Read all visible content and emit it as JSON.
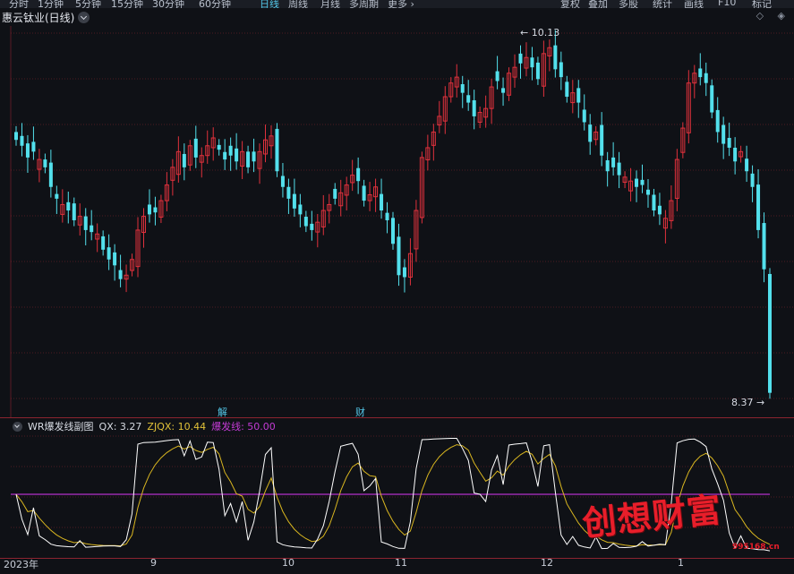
{
  "toolbar": {
    "items": [
      {
        "label": "分时",
        "active": false
      },
      {
        "label": "1分钟",
        "active": false
      },
      {
        "label": "5分钟",
        "active": false
      },
      {
        "label": "15分钟",
        "active": false
      },
      {
        "label": "30分钟",
        "active": false
      },
      {
        "label": "60分钟",
        "active": false
      },
      {
        "label": "日线",
        "active": true
      },
      {
        "label": "周线",
        "active": false
      },
      {
        "label": "月线",
        "active": false
      },
      {
        "label": "多周期",
        "active": false
      },
      {
        "label": "更多 ›",
        "active": false
      }
    ],
    "right_items": [
      "复权",
      "叠加",
      "多股",
      "统计",
      "画线",
      "F10",
      "标记"
    ]
  },
  "chart": {
    "title": "惠云钛业(日线)",
    "price_high_label": "10.13",
    "price_low_label": "8.37",
    "markers": [
      "解",
      "财"
    ],
    "right_icons": "◇ ◈"
  },
  "indicator": {
    "name": "WR爆发线副图",
    "qx_label": "QX: 3.27",
    "zjqx_label": "ZJQX: 10.44",
    "bfx_label": "爆发线: 50.00"
  },
  "xaxis": {
    "labels": [
      "2023年",
      "9",
      "10",
      "11",
      "12",
      "1"
    ]
  },
  "watermark": {
    "text": "创想财富",
    "url": "995168.cn"
  },
  "colors": {
    "up": "#e0313c",
    "down": "#53e0ec",
    "qx": "#ffffff",
    "zjqx": "#d9b620",
    "bfx": "#b331c9",
    "grid": "#8b2430"
  },
  "chart_data": {
    "type": "candlestick",
    "title": "惠云钛业(日线)",
    "ylim": [
      8.3,
      10.25
    ],
    "price_high": 10.13,
    "price_low": 8.37,
    "closes": [
      9.66,
      9.63,
      9.57,
      9.6,
      9.56,
      9.52,
      9.42,
      9.36,
      9.33,
      9.3,
      9.25,
      9.27,
      9.2,
      9.19,
      9.18,
      9.1,
      9.05,
      9.02,
      8.95,
      8.97,
      9.05,
      9.2,
      9.27,
      9.28,
      9.29,
      9.35,
      9.43,
      9.52,
      9.6,
      9.52,
      9.63,
      9.57,
      9.58,
      9.63,
      9.67,
      9.61,
      9.56,
      9.58,
      9.55,
      9.6,
      9.52,
      9.55,
      9.6,
      9.66,
      9.68,
      9.5,
      9.42,
      9.36,
      9.31,
      9.28,
      9.22,
      9.2,
      9.24,
      9.3,
      9.33,
      9.36,
      9.39,
      9.43,
      9.48,
      9.45,
      9.35,
      9.38,
      9.42,
      9.3,
      9.25,
      9.13,
      8.97,
      8.96,
      9.08,
      9.3,
      9.57,
      9.62,
      9.7,
      9.78,
      9.88,
      9.95,
      9.98,
      9.9,
      9.85,
      9.78,
      9.8,
      9.82,
      9.93,
      9.96,
      9.9,
      10.0,
      10.03,
      10.05,
      10.08,
      10.03,
      9.97,
      10.1,
      10.13,
      10.02,
      9.98,
      9.88,
      9.9,
      9.85,
      9.75,
      9.65,
      9.7,
      9.58,
      9.5,
      9.52,
      9.48,
      9.47,
      9.45,
      9.42,
      9.43,
      9.38,
      9.3,
      9.28,
      9.26,
      9.35,
      9.56,
      9.72,
      9.95,
      10.0,
      9.98,
      9.95,
      9.8,
      9.7,
      9.64,
      9.62,
      9.55,
      9.6,
      9.5,
      9.42,
      9.2,
      9.0,
      8.37
    ]
  }
}
